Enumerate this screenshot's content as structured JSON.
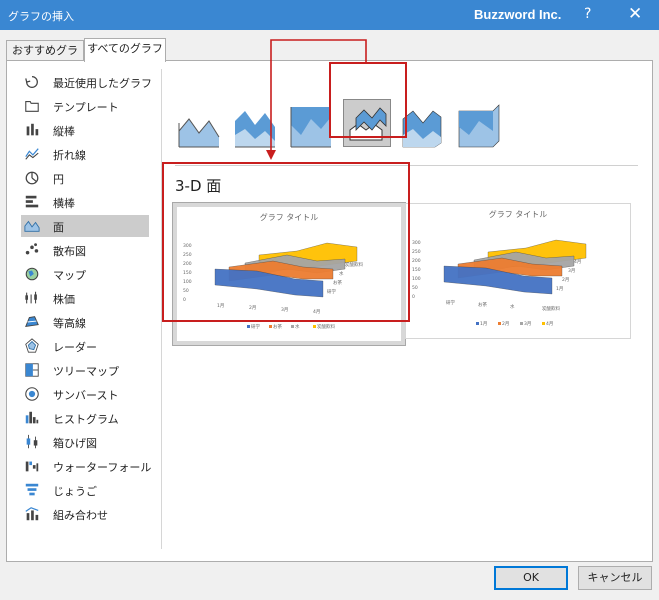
{
  "window": {
    "title": "グラフの挿入",
    "brand": "Buzzword Inc.",
    "help": "?",
    "close": "✕"
  },
  "tabs": [
    "おすすめグラフ",
    "すべてのグラフ"
  ],
  "categories": [
    {
      "label": "最近使用したグラフ",
      "icon": "recent-icon"
    },
    {
      "label": "テンプレート",
      "icon": "template-folder-icon"
    },
    {
      "label": "縦棒",
      "icon": "column-chart-icon"
    },
    {
      "label": "折れ線",
      "icon": "line-chart-icon"
    },
    {
      "label": "円",
      "icon": "pie-chart-icon"
    },
    {
      "label": "横棒",
      "icon": "bar-chart-icon"
    },
    {
      "label": "面",
      "icon": "area-chart-icon"
    },
    {
      "label": "散布図",
      "icon": "scatter-chart-icon"
    },
    {
      "label": "マップ",
      "icon": "map-chart-icon"
    },
    {
      "label": "株価",
      "icon": "stock-chart-icon"
    },
    {
      "label": "等高線",
      "icon": "surface-chart-icon"
    },
    {
      "label": "レーダー",
      "icon": "radar-chart-icon"
    },
    {
      "label": "ツリーマップ",
      "icon": "treemap-chart-icon"
    },
    {
      "label": "サンバースト",
      "icon": "sunburst-chart-icon"
    },
    {
      "label": "ヒストグラム",
      "icon": "histogram-chart-icon"
    },
    {
      "label": "箱ひげ図",
      "icon": "box-whisker-chart-icon"
    },
    {
      "label": "ウォーターフォール",
      "icon": "waterfall-chart-icon"
    },
    {
      "label": "じょうご",
      "icon": "funnel-chart-icon"
    },
    {
      "label": "組み合わせ",
      "icon": "combo-chart-icon"
    }
  ],
  "selected_category_index": 6,
  "section_title": "3-D 面",
  "previews": [
    {
      "title": "グラフ タイトル",
      "yticks": [
        "300",
        "250",
        "200",
        "150",
        "100",
        "50",
        "0"
      ],
      "xticks": [
        "1月",
        "2月",
        "3月",
        "4月"
      ],
      "depth_labels": [
        "研学",
        "お茶",
        "水",
        "炭酸飲料"
      ],
      "legend": [
        "研学",
        "お茶",
        "水",
        "炭酸飲料"
      ]
    },
    {
      "title": "グラフ タイトル",
      "yticks": [
        "300",
        "250",
        "200",
        "150",
        "100",
        "50",
        "0"
      ],
      "xticks": [
        "研学",
        "お茶",
        "水",
        "炭酸飲料"
      ],
      "depth_labels": [
        "1月",
        "2月",
        "3月",
        "4月"
      ],
      "legend": [
        "1月",
        "2月",
        "3月",
        "4月"
      ]
    }
  ],
  "series_colors": [
    "#4472c4",
    "#ed7d31",
    "#a5a5a5",
    "#ffc000"
  ],
  "buttons": {
    "ok": "OK",
    "cancel": "キャンセル"
  }
}
